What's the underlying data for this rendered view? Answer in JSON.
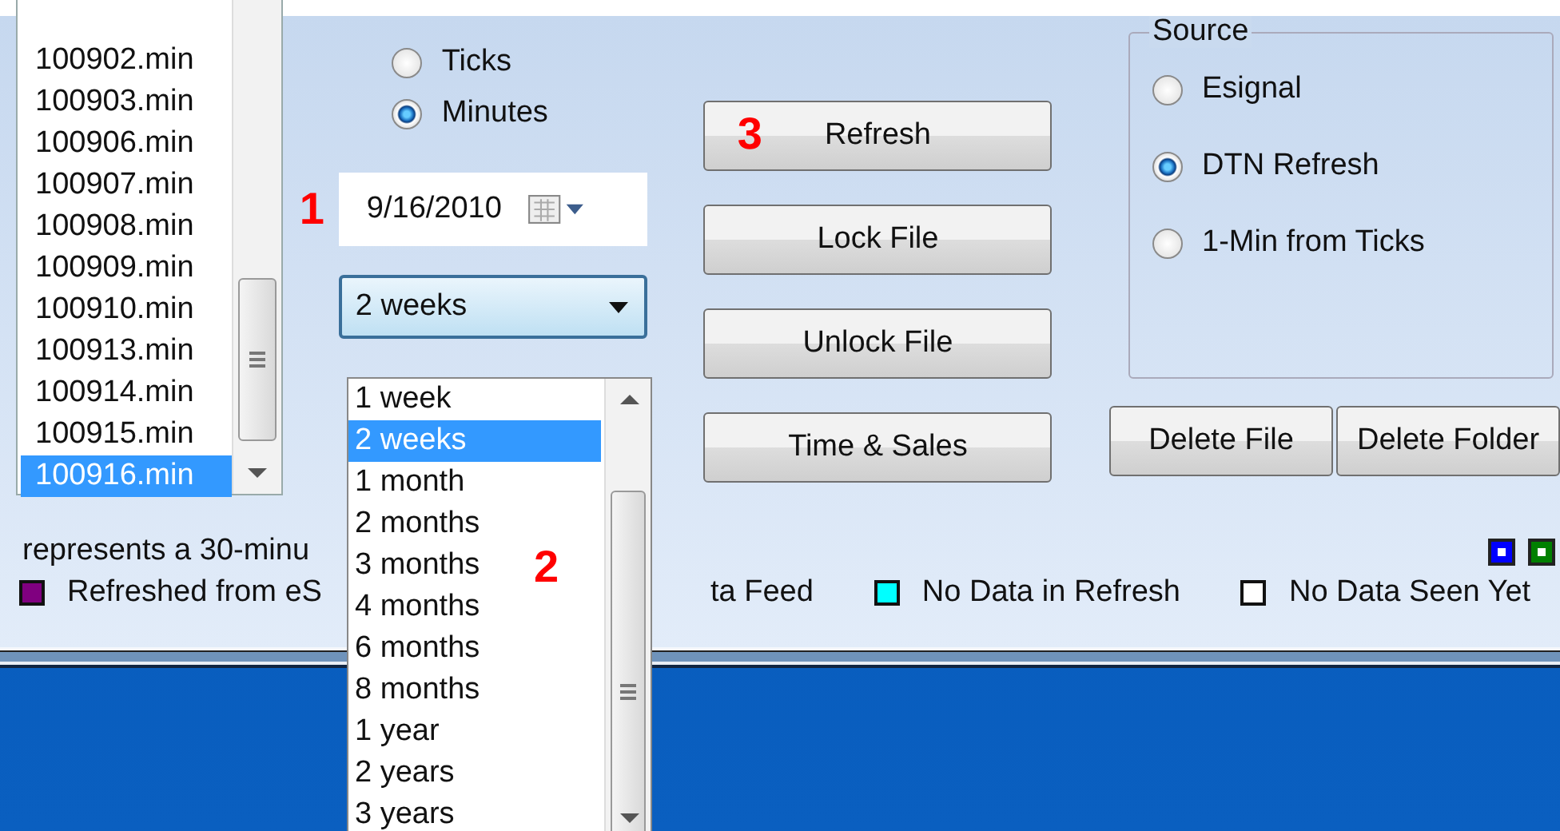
{
  "file_list": {
    "items": [
      {
        "label": "100902.min",
        "selected": false
      },
      {
        "label": "100903.min",
        "selected": false
      },
      {
        "label": "100906.min",
        "selected": false
      },
      {
        "label": "100907.min",
        "selected": false
      },
      {
        "label": "100908.min",
        "selected": false
      },
      {
        "label": "100909.min",
        "selected": false
      },
      {
        "label": "100910.min",
        "selected": false
      },
      {
        "label": "100913.min",
        "selected": false
      },
      {
        "label": "100914.min",
        "selected": false
      },
      {
        "label": "100915.min",
        "selected": false
      },
      {
        "label": "100916.min",
        "selected": true
      }
    ]
  },
  "data_type": [
    {
      "label": "Ticks",
      "selected": false
    },
    {
      "label": "Minutes",
      "selected": true
    }
  ],
  "date_field": {
    "marker": "1",
    "value": "9/16/2010"
  },
  "period_combo": {
    "value": "2 weeks"
  },
  "period_popup": {
    "marker": "2",
    "items": [
      {
        "label": "1 week",
        "selected": false
      },
      {
        "label": "2 weeks",
        "selected": true
      },
      {
        "label": "1 month",
        "selected": false
      },
      {
        "label": "2 months",
        "selected": false
      },
      {
        "label": "3 months",
        "selected": false
      },
      {
        "label": "4 months",
        "selected": false
      },
      {
        "label": "6 months",
        "selected": false
      },
      {
        "label": "8 months",
        "selected": false
      },
      {
        "label": "1 year",
        "selected": false
      },
      {
        "label": "2 years",
        "selected": false
      },
      {
        "label": "3 years",
        "selected": false
      }
    ]
  },
  "buttons": [
    {
      "label": "Refresh",
      "marker": "3"
    },
    {
      "label": "Lock File"
    },
    {
      "label": "Unlock File"
    },
    {
      "label": "Time & Sales"
    }
  ],
  "source": {
    "title": "Source",
    "options": [
      {
        "label": "Esignal",
        "selected": false
      },
      {
        "label": "DTN Refresh",
        "selected": true
      },
      {
        "label": "1-Min from Ticks",
        "selected": false
      }
    ]
  },
  "delete_buttons": [
    "Delete File",
    "Delete Folder"
  ],
  "legend": {
    "note": "represents a 30-minu",
    "markers": [
      {
        "color": "#0000ff"
      },
      {
        "color": "#008000"
      }
    ],
    "items": [
      {
        "label": "Refreshed from eS",
        "color": "#800080"
      },
      {
        "label": "ta Feed"
      },
      {
        "label": "No Data in Refresh",
        "color": "#00ffff"
      },
      {
        "label": "No Data Seen Yet",
        "color": "#ffffff"
      }
    ]
  }
}
